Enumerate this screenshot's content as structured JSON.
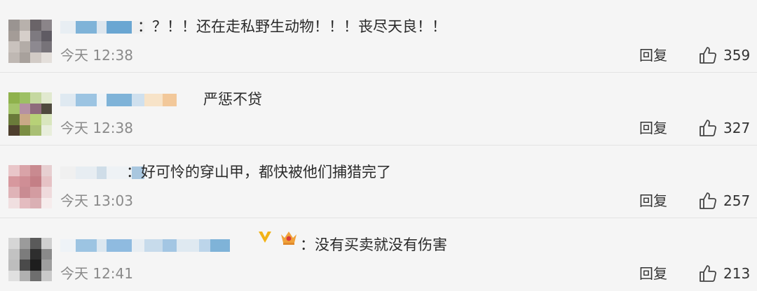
{
  "comments": [
    {
      "text": "：？！！还在走私野生动物！！！丧尽天良！！",
      "time": "今天 12:38",
      "reply_label": "回复",
      "like_count": "359",
      "avatar_pixels": [
        "#9a9491",
        "#b8b1ac",
        "#6a6468",
        "#8b8589",
        "#a49c97",
        "#d6cfca",
        "#7e7a80",
        "#5f5b63",
        "#c9c2bd",
        "#b3aca7",
        "#8d8990",
        "#777379",
        "#bfb8b3",
        "#a8a19c",
        "#d2cbc6",
        "#e4dfdb"
      ],
      "name_blocks": [
        "#e8eef3",
        "#7fb3d8",
        "#dde6ee",
        "#6aa6d2",
        "#f0f0f0"
      ]
    },
    {
      "text": "严惩不贷",
      "time": "今天 12:38",
      "reply_label": "回复",
      "like_count": "327",
      "avatar_pixels": [
        "#8fb24c",
        "#9dc064",
        "#c5d8a0",
        "#e1e9cf",
        "#a5c46b",
        "#b591a3",
        "#8e6b7c",
        "#4f4a3e",
        "#6a7a3a",
        "#c9a986",
        "#b7d177",
        "#d9e6be",
        "#4e3f2e",
        "#7b8d43",
        "#a9bf74",
        "#e8eedc"
      ],
      "name_blocks": [
        "#dfe9f1",
        "#9cc4e2",
        "#eef3f7",
        "#7fb3d8",
        "#cfe0ee",
        "#f7e3c8",
        "#f2c89a"
      ]
    },
    {
      "text": "：好可怜的穿山甲，都快被他们捕猎完了",
      "time": "今天 13:03",
      "reply_label": "回复",
      "like_count": "257",
      "avatar_pixels": [
        "#e9c6c9",
        "#d9a3a8",
        "#c98a90",
        "#e7cfd1",
        "#d7989e",
        "#cf8e95",
        "#c47f86",
        "#e6c2c5",
        "#dfb3b7",
        "#c98b92",
        "#d39ca1",
        "#efdadc",
        "#f0dfe0",
        "#e4bcc0",
        "#dab0b4",
        "#f6ecec"
      ],
      "name_blocks": [
        "#f0f0f0",
        "#e7edf2",
        "#cfdde8",
        "#eef2f5",
        "#a9c7df"
      ]
    },
    {
      "text": "：没有买卖就没有伤害",
      "time": "今天 12:41",
      "reply_label": "回复",
      "like_count": "213",
      "avatar_pixels": [
        "#d6d6d6",
        "#9b9b9b",
        "#5a5a5a",
        "#cfcfcf",
        "#c2c2c2",
        "#7c7c7c",
        "#2e2e2e",
        "#8a8a8a",
        "#bdbdbd",
        "#4a4a4a",
        "#1e1e1e",
        "#9e9e9e",
        "#e0e0e0",
        "#b0b0b0",
        "#6e6e6e",
        "#cacaca"
      ],
      "name_blocks": [
        "#eef3f7",
        "#9cc4e2",
        "#dbe7f0",
        "#8fbbe0",
        "#e8eef3",
        "#c7dbeb",
        "#a3c6e3",
        "#dfe9f1",
        "#bcd5ea",
        "#7fb3d8"
      ]
    }
  ],
  "colors": {
    "background": "#f5f5f5",
    "text": "#2a2a2a",
    "muted": "#8a8a8a",
    "divider": "#e3e3e3",
    "vip_badge": "#f2b316",
    "crown_badge": "#f0a23a"
  },
  "icons": {
    "like": "thumbs-up-icon",
    "vip": "vip-badge-icon",
    "crown": "crown-badge-icon"
  }
}
